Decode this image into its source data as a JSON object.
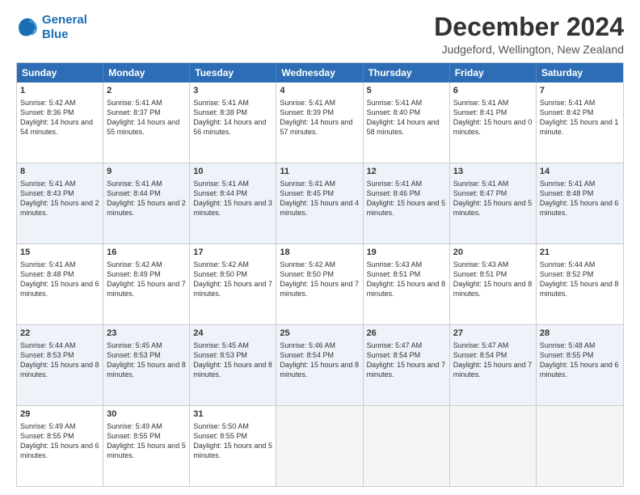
{
  "logo": {
    "line1": "General",
    "line2": "Blue"
  },
  "title": "December 2024",
  "subtitle": "Judgeford, Wellington, New Zealand",
  "days": [
    "Sunday",
    "Monday",
    "Tuesday",
    "Wednesday",
    "Thursday",
    "Friday",
    "Saturday"
  ],
  "weeks": [
    [
      {
        "num": "1",
        "sunrise": "Sunrise: 5:42 AM",
        "sunset": "Sunset: 8:36 PM",
        "daylight": "Daylight: 14 hours and 54 minutes."
      },
      {
        "num": "2",
        "sunrise": "Sunrise: 5:41 AM",
        "sunset": "Sunset: 8:37 PM",
        "daylight": "Daylight: 14 hours and 55 minutes."
      },
      {
        "num": "3",
        "sunrise": "Sunrise: 5:41 AM",
        "sunset": "Sunset: 8:38 PM",
        "daylight": "Daylight: 14 hours and 56 minutes."
      },
      {
        "num": "4",
        "sunrise": "Sunrise: 5:41 AM",
        "sunset": "Sunset: 8:39 PM",
        "daylight": "Daylight: 14 hours and 57 minutes."
      },
      {
        "num": "5",
        "sunrise": "Sunrise: 5:41 AM",
        "sunset": "Sunset: 8:40 PM",
        "daylight": "Daylight: 14 hours and 58 minutes."
      },
      {
        "num": "6",
        "sunrise": "Sunrise: 5:41 AM",
        "sunset": "Sunset: 8:41 PM",
        "daylight": "Daylight: 15 hours and 0 minutes."
      },
      {
        "num": "7",
        "sunrise": "Sunrise: 5:41 AM",
        "sunset": "Sunset: 8:42 PM",
        "daylight": "Daylight: 15 hours and 1 minute."
      }
    ],
    [
      {
        "num": "8",
        "sunrise": "Sunrise: 5:41 AM",
        "sunset": "Sunset: 8:43 PM",
        "daylight": "Daylight: 15 hours and 2 minutes."
      },
      {
        "num": "9",
        "sunrise": "Sunrise: 5:41 AM",
        "sunset": "Sunset: 8:44 PM",
        "daylight": "Daylight: 15 hours and 2 minutes."
      },
      {
        "num": "10",
        "sunrise": "Sunrise: 5:41 AM",
        "sunset": "Sunset: 8:44 PM",
        "daylight": "Daylight: 15 hours and 3 minutes."
      },
      {
        "num": "11",
        "sunrise": "Sunrise: 5:41 AM",
        "sunset": "Sunset: 8:45 PM",
        "daylight": "Daylight: 15 hours and 4 minutes."
      },
      {
        "num": "12",
        "sunrise": "Sunrise: 5:41 AM",
        "sunset": "Sunset: 8:46 PM",
        "daylight": "Daylight: 15 hours and 5 minutes."
      },
      {
        "num": "13",
        "sunrise": "Sunrise: 5:41 AM",
        "sunset": "Sunset: 8:47 PM",
        "daylight": "Daylight: 15 hours and 5 minutes."
      },
      {
        "num": "14",
        "sunrise": "Sunrise: 5:41 AM",
        "sunset": "Sunset: 8:48 PM",
        "daylight": "Daylight: 15 hours and 6 minutes."
      }
    ],
    [
      {
        "num": "15",
        "sunrise": "Sunrise: 5:41 AM",
        "sunset": "Sunset: 8:48 PM",
        "daylight": "Daylight: 15 hours and 6 minutes."
      },
      {
        "num": "16",
        "sunrise": "Sunrise: 5:42 AM",
        "sunset": "Sunset: 8:49 PM",
        "daylight": "Daylight: 15 hours and 7 minutes."
      },
      {
        "num": "17",
        "sunrise": "Sunrise: 5:42 AM",
        "sunset": "Sunset: 8:50 PM",
        "daylight": "Daylight: 15 hours and 7 minutes."
      },
      {
        "num": "18",
        "sunrise": "Sunrise: 5:42 AM",
        "sunset": "Sunset: 8:50 PM",
        "daylight": "Daylight: 15 hours and 7 minutes."
      },
      {
        "num": "19",
        "sunrise": "Sunrise: 5:43 AM",
        "sunset": "Sunset: 8:51 PM",
        "daylight": "Daylight: 15 hours and 8 minutes."
      },
      {
        "num": "20",
        "sunrise": "Sunrise: 5:43 AM",
        "sunset": "Sunset: 8:51 PM",
        "daylight": "Daylight: 15 hours and 8 minutes."
      },
      {
        "num": "21",
        "sunrise": "Sunrise: 5:44 AM",
        "sunset": "Sunset: 8:52 PM",
        "daylight": "Daylight: 15 hours and 8 minutes."
      }
    ],
    [
      {
        "num": "22",
        "sunrise": "Sunrise: 5:44 AM",
        "sunset": "Sunset: 8:53 PM",
        "daylight": "Daylight: 15 hours and 8 minutes."
      },
      {
        "num": "23",
        "sunrise": "Sunrise: 5:45 AM",
        "sunset": "Sunset: 8:53 PM",
        "daylight": "Daylight: 15 hours and 8 minutes."
      },
      {
        "num": "24",
        "sunrise": "Sunrise: 5:45 AM",
        "sunset": "Sunset: 8:53 PM",
        "daylight": "Daylight: 15 hours and 8 minutes."
      },
      {
        "num": "25",
        "sunrise": "Sunrise: 5:46 AM",
        "sunset": "Sunset: 8:54 PM",
        "daylight": "Daylight: 15 hours and 8 minutes."
      },
      {
        "num": "26",
        "sunrise": "Sunrise: 5:47 AM",
        "sunset": "Sunset: 8:54 PM",
        "daylight": "Daylight: 15 hours and 7 minutes."
      },
      {
        "num": "27",
        "sunrise": "Sunrise: 5:47 AM",
        "sunset": "Sunset: 8:54 PM",
        "daylight": "Daylight: 15 hours and 7 minutes."
      },
      {
        "num": "28",
        "sunrise": "Sunrise: 5:48 AM",
        "sunset": "Sunset: 8:55 PM",
        "daylight": "Daylight: 15 hours and 6 minutes."
      }
    ],
    [
      {
        "num": "29",
        "sunrise": "Sunrise: 5:49 AM",
        "sunset": "Sunset: 8:55 PM",
        "daylight": "Daylight: 15 hours and 6 minutes."
      },
      {
        "num": "30",
        "sunrise": "Sunrise: 5:49 AM",
        "sunset": "Sunset: 8:55 PM",
        "daylight": "Daylight: 15 hours and 5 minutes."
      },
      {
        "num": "31",
        "sunrise": "Sunrise: 5:50 AM",
        "sunset": "Sunset: 8:55 PM",
        "daylight": "Daylight: 15 hours and 5 minutes."
      },
      null,
      null,
      null,
      null
    ]
  ]
}
